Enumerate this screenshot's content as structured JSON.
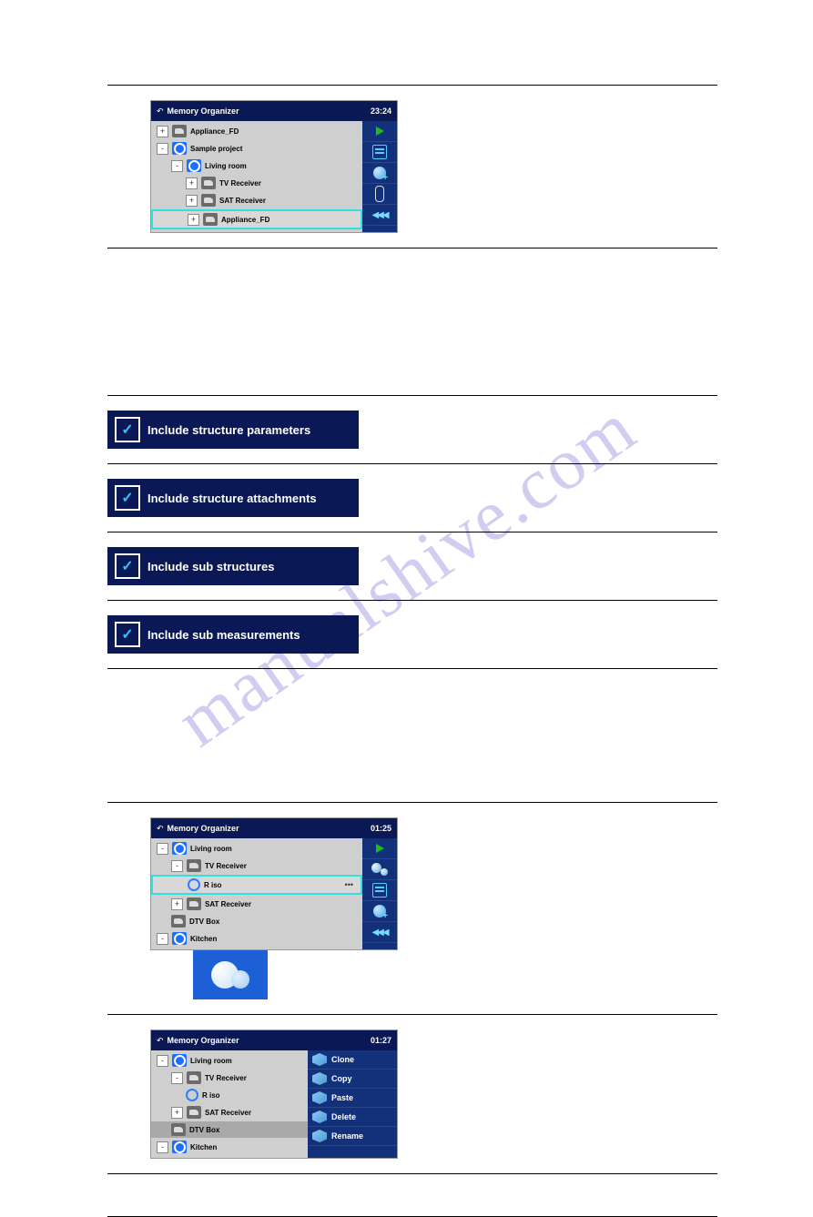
{
  "watermark": "manualshive.com",
  "screens": {
    "s1": {
      "title": "Memory Organizer",
      "clock": "23:24",
      "tree": [
        {
          "level": 0,
          "exp": "+",
          "iconType": "gray",
          "label": "Appliance_FD"
        },
        {
          "level": 0,
          "exp": "-",
          "iconType": "blue",
          "label": "Sample project"
        },
        {
          "level": 1,
          "exp": "-",
          "iconType": "blue",
          "label": "Living room"
        },
        {
          "level": 2,
          "exp": "+",
          "iconType": "gray",
          "label": "TV Receiver"
        },
        {
          "level": 2,
          "exp": "+",
          "iconType": "gray",
          "label": "SAT Receiver"
        },
        {
          "level": 2,
          "exp": "+",
          "iconType": "gray",
          "label": "Appliance_FD",
          "selected": true
        }
      ]
    },
    "s2": {
      "title": "Memory Organizer",
      "clock": "01:25",
      "tree": [
        {
          "level": 0,
          "exp": "-",
          "iconType": "blue",
          "label": "Living room"
        },
        {
          "level": 1,
          "exp": "-",
          "iconType": "gray",
          "label": "TV Receiver"
        },
        {
          "level": 2,
          "ring": true,
          "label": "R iso",
          "selected": true,
          "dots": true
        },
        {
          "level": 1,
          "exp": "+",
          "iconType": "gray",
          "label": "SAT Receiver"
        },
        {
          "level": 1,
          "iconType": "gray",
          "label": "DTV Box"
        },
        {
          "level": 0,
          "exp": "-",
          "iconType": "blue",
          "label": "Kitchen"
        }
      ]
    },
    "s3": {
      "title": "Memory Organizer",
      "clock": "01:27",
      "tree": [
        {
          "level": 0,
          "exp": "-",
          "iconType": "blue",
          "label": "Living room"
        },
        {
          "level": 1,
          "exp": "-",
          "iconType": "gray",
          "label": "TV Receiver"
        },
        {
          "level": 2,
          "ring": true,
          "label": "R iso"
        },
        {
          "level": 1,
          "exp": "+",
          "iconType": "gray",
          "label": "SAT Receiver"
        },
        {
          "level": 1,
          "iconType": "gray",
          "label": "DTV Box",
          "selDark": true
        },
        {
          "level": 0,
          "exp": "-",
          "iconType": "blue",
          "label": "Kitchen"
        }
      ],
      "menu": [
        "Clone",
        "Copy",
        "Paste",
        "Delete",
        "Rename"
      ]
    }
  },
  "options": {
    "o1": "Include structure parameters",
    "o2": "Include structure attachments",
    "o3": "Include sub structures",
    "o4": "Include sub measurements"
  }
}
